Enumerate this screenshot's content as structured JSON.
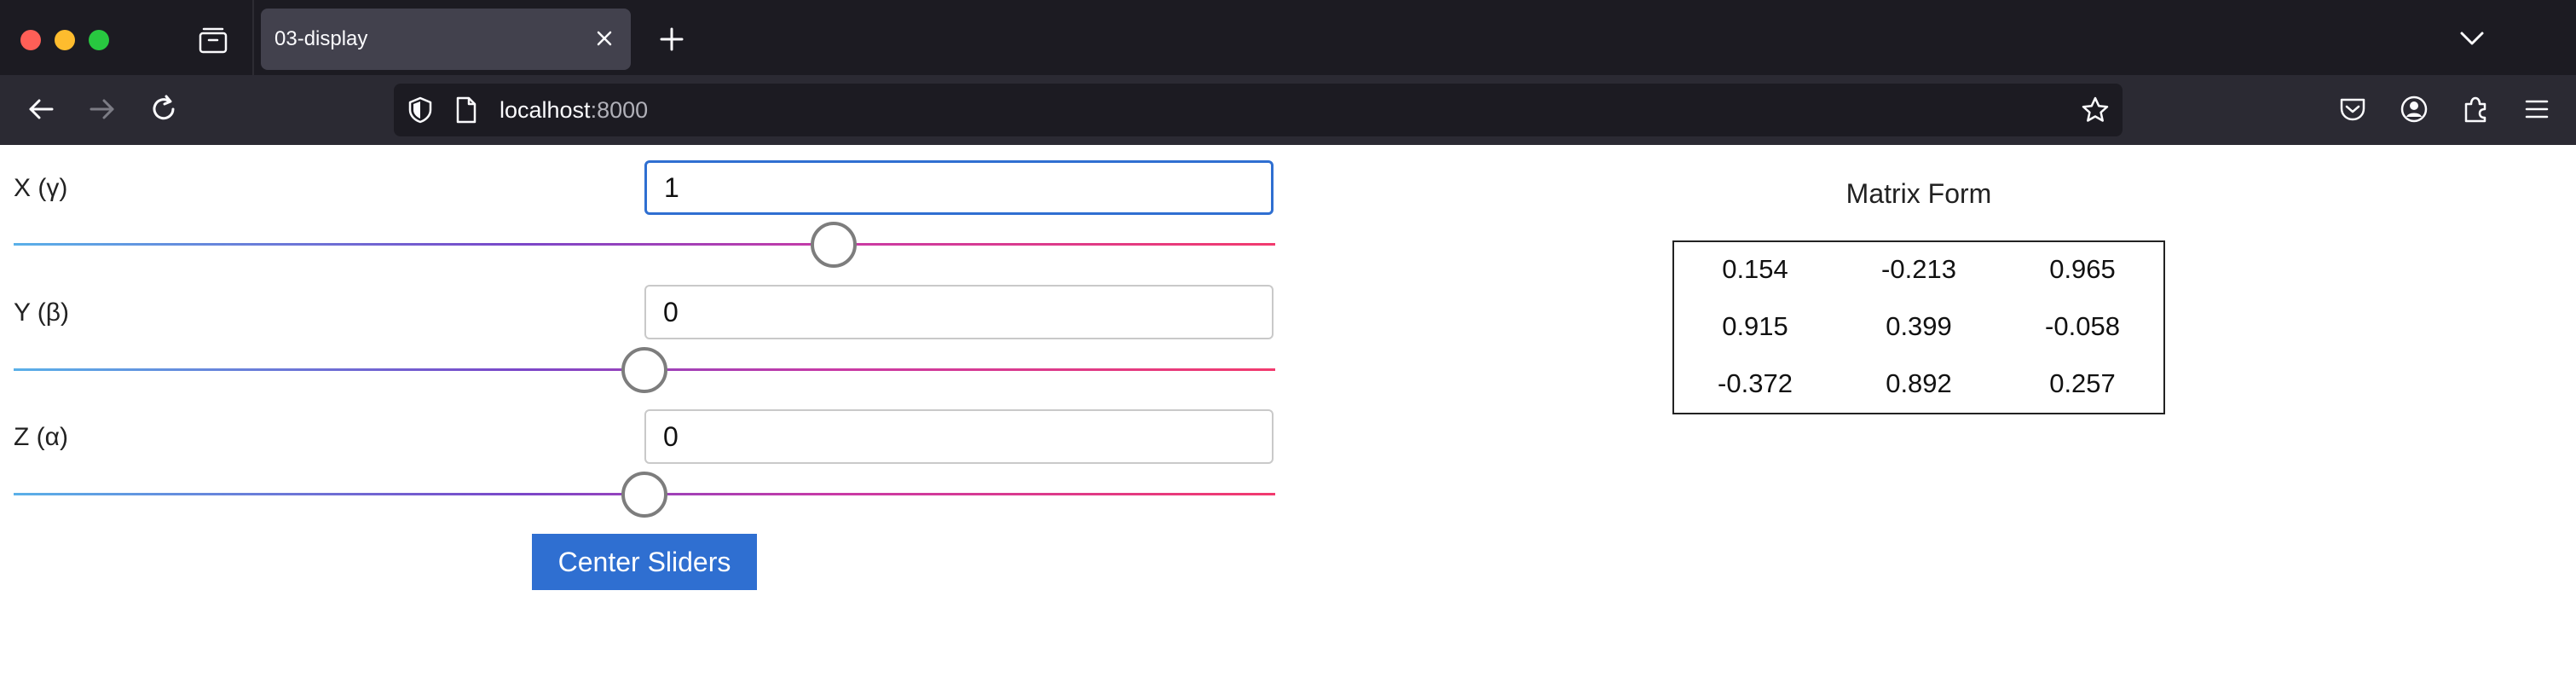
{
  "browser": {
    "tab_title": "03-display",
    "url_host": "localhost",
    "url_port": ":8000"
  },
  "controls": [
    {
      "label": "X (γ)",
      "value": "1",
      "slider_fraction": 0.65
    },
    {
      "label": "Y (β)",
      "value": "0",
      "slider_fraction": 0.5
    },
    {
      "label": "Z (α)",
      "value": "0",
      "slider_fraction": 0.5
    }
  ],
  "center_button_label": "Center Sliders",
  "matrix": {
    "title": "Matrix Form",
    "rows": [
      [
        "0.154",
        "-0.213",
        "0.965"
      ],
      [
        "0.915",
        "0.399",
        "-0.058"
      ],
      [
        "-0.372",
        "0.892",
        "0.257"
      ]
    ]
  },
  "colors": {
    "button_blue": "#2f6fd1",
    "chrome_dark": "#1c1b22",
    "tab_active": "#42414d"
  }
}
